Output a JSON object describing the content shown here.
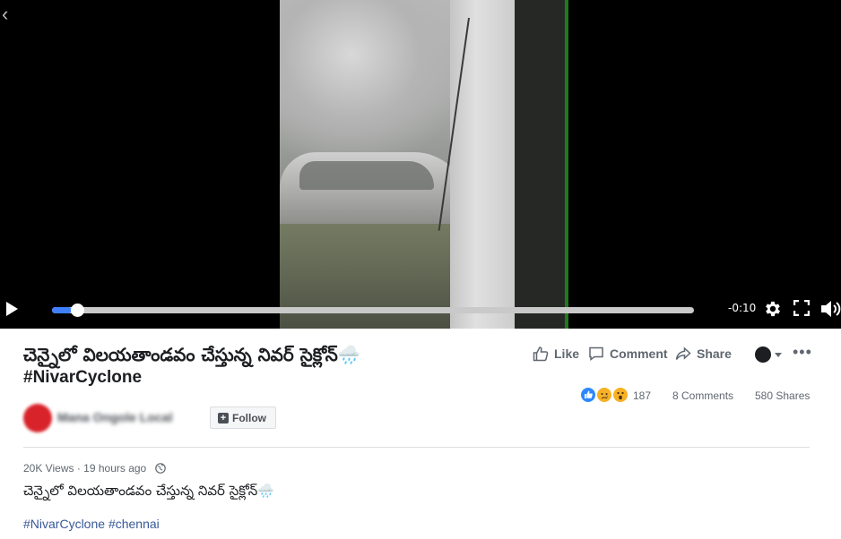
{
  "video": {
    "time_remaining": "-0:10",
    "progress": 0.02,
    "accent_color": "#4080ff"
  },
  "post": {
    "title": "చెన్నైలో విలయతాండవం చేస్తున్న నివర్ సైక్లోన్🌧️",
    "title_hashtag": "#NivarCyclone",
    "page_name": "Mana Ongole Local",
    "follow_label": "Follow",
    "actions": {
      "like": "Like",
      "comment": "Comment",
      "share": "Share"
    },
    "reaction_count": "187",
    "comments": "8 Comments",
    "shares": "580 Shares",
    "views": "20K Views",
    "time_ago": "19 hours ago",
    "description": "చెన్నైలో విలయతాండవం చేస్తున్న నివర్ సైక్లోన్🌧️",
    "tags": [
      "#NivarCyclone",
      "#chennai"
    ]
  },
  "icons": {
    "back": "chevron-left-icon",
    "play": "play-icon",
    "settings": "gear-icon",
    "fullscreen": "fullscreen-icon",
    "volume": "volume-icon",
    "like": "thumbs-up-icon",
    "comment": "comment-icon",
    "share": "share-icon",
    "more": "more-icon",
    "privacy": "globe-icon"
  }
}
